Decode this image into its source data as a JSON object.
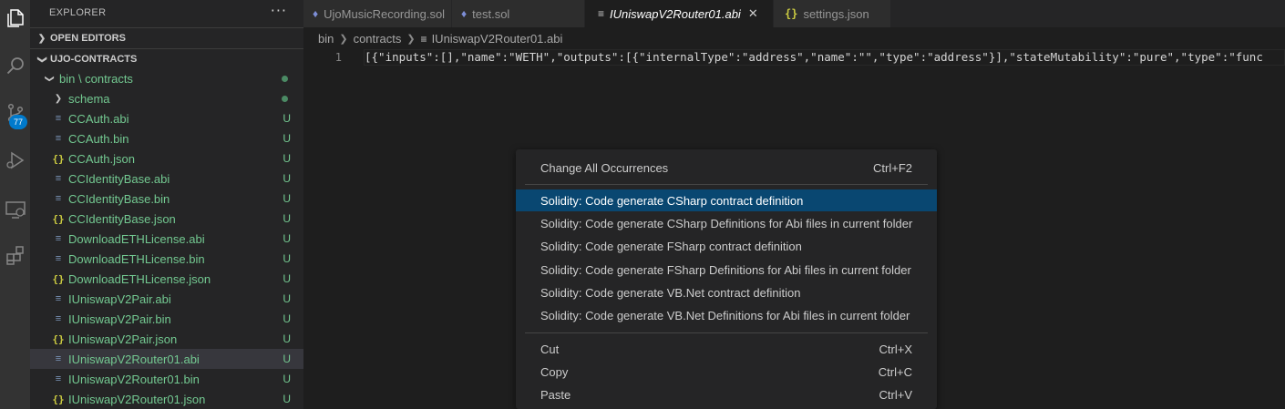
{
  "activity_bar": {
    "icons": [
      "explorer-icon",
      "search-icon",
      "source-control-icon",
      "run-debug-icon",
      "remote-explorer-icon",
      "extensions-icon"
    ],
    "scm_badge": "77"
  },
  "sidebar": {
    "title": "EXPLORER",
    "more": "···",
    "open_editors": "OPEN EDITORS",
    "root": "UJO-CONTRACTS",
    "folder_bin": "bin \\ contracts",
    "folder_schema": "schema",
    "files": [
      {
        "name": "CCAuth.abi",
        "type": "abi",
        "status": "U"
      },
      {
        "name": "CCAuth.bin",
        "type": "abi",
        "status": "U"
      },
      {
        "name": "CCAuth.json",
        "type": "json",
        "status": "U"
      },
      {
        "name": "CCIdentityBase.abi",
        "type": "abi",
        "status": "U"
      },
      {
        "name": "CCIdentityBase.bin",
        "type": "abi",
        "status": "U"
      },
      {
        "name": "CCIdentityBase.json",
        "type": "json",
        "status": "U"
      },
      {
        "name": "DownloadETHLicense.abi",
        "type": "abi",
        "status": "U"
      },
      {
        "name": "DownloadETHLicense.bin",
        "type": "abi",
        "status": "U"
      },
      {
        "name": "DownloadETHLicense.json",
        "type": "json",
        "status": "U"
      },
      {
        "name": "IUniswapV2Pair.abi",
        "type": "abi",
        "status": "U"
      },
      {
        "name": "IUniswapV2Pair.bin",
        "type": "abi",
        "status": "U"
      },
      {
        "name": "IUniswapV2Pair.json",
        "type": "json",
        "status": "U"
      },
      {
        "name": "IUniswapV2Router01.abi",
        "type": "abi",
        "status": "U",
        "selected": true
      },
      {
        "name": "IUniswapV2Router01.bin",
        "type": "abi",
        "status": "U"
      },
      {
        "name": "IUniswapV2Router01.json",
        "type": "json",
        "status": "U"
      }
    ]
  },
  "tabs": [
    {
      "label": "UjoMusicRecording.sol",
      "icon": "sol"
    },
    {
      "label": "test.sol",
      "icon": "sol"
    },
    {
      "label": "IUniswapV2Router01.abi",
      "icon": "abi",
      "active": true
    },
    {
      "label": "settings.json",
      "icon": "json"
    }
  ],
  "breadcrumb": [
    "bin",
    "contracts",
    "IUniswapV2Router01.abi"
  ],
  "editor": {
    "line_number": "1",
    "code": "[{\"inputs\":[],\"name\":\"WETH\",\"outputs\":[{\"internalType\":\"address\",\"name\":\"\",\"type\":\"address\"}],\"stateMutability\":\"pure\",\"type\":\"func"
  },
  "context_menu": {
    "groups": [
      [
        {
          "label": "Change All Occurrences",
          "shortcut": "Ctrl+F2"
        }
      ],
      [
        {
          "label": "Solidity: Code generate CSharp contract definition",
          "shortcut": "",
          "highlight": true
        },
        {
          "label": "Solidity: Code generate CSharp Definitions for Abi files in current folder",
          "shortcut": ""
        },
        {
          "label": "Solidity: Code generate FSharp contract definition",
          "shortcut": ""
        },
        {
          "label": "Solidity: Code generate FSharp Definitions for Abi files in current folder",
          "shortcut": ""
        },
        {
          "label": "Solidity: Code generate VB.Net contract definition",
          "shortcut": ""
        },
        {
          "label": "Solidity: Code generate VB.Net Definitions for Abi files in current folder",
          "shortcut": ""
        }
      ],
      [
        {
          "label": "Cut",
          "shortcut": "Ctrl+X"
        },
        {
          "label": "Copy",
          "shortcut": "Ctrl+C"
        },
        {
          "label": "Paste",
          "shortcut": "Ctrl+V"
        }
      ]
    ]
  },
  "colors": {
    "accent": "#007acc",
    "untracked_text": "#73c991",
    "menu_highlight": "#094771"
  }
}
